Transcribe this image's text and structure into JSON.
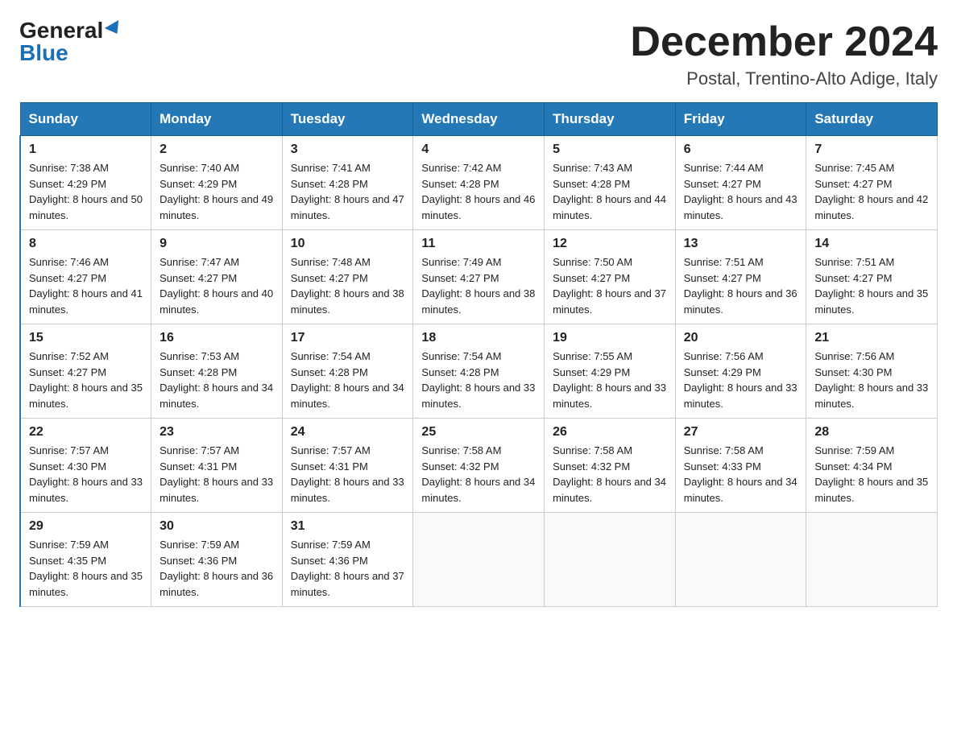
{
  "header": {
    "logo_general": "General",
    "logo_blue": "Blue",
    "month_title": "December 2024",
    "location": "Postal, Trentino-Alto Adige, Italy"
  },
  "weekdays": [
    "Sunday",
    "Monday",
    "Tuesday",
    "Wednesday",
    "Thursday",
    "Friday",
    "Saturday"
  ],
  "weeks": [
    [
      {
        "day": 1,
        "sunrise": "7:38 AM",
        "sunset": "4:29 PM",
        "daylight": "8 hours and 50 minutes."
      },
      {
        "day": 2,
        "sunrise": "7:40 AM",
        "sunset": "4:29 PM",
        "daylight": "8 hours and 49 minutes."
      },
      {
        "day": 3,
        "sunrise": "7:41 AM",
        "sunset": "4:28 PM",
        "daylight": "8 hours and 47 minutes."
      },
      {
        "day": 4,
        "sunrise": "7:42 AM",
        "sunset": "4:28 PM",
        "daylight": "8 hours and 46 minutes."
      },
      {
        "day": 5,
        "sunrise": "7:43 AM",
        "sunset": "4:28 PM",
        "daylight": "8 hours and 44 minutes."
      },
      {
        "day": 6,
        "sunrise": "7:44 AM",
        "sunset": "4:27 PM",
        "daylight": "8 hours and 43 minutes."
      },
      {
        "day": 7,
        "sunrise": "7:45 AM",
        "sunset": "4:27 PM",
        "daylight": "8 hours and 42 minutes."
      }
    ],
    [
      {
        "day": 8,
        "sunrise": "7:46 AM",
        "sunset": "4:27 PM",
        "daylight": "8 hours and 41 minutes."
      },
      {
        "day": 9,
        "sunrise": "7:47 AM",
        "sunset": "4:27 PM",
        "daylight": "8 hours and 40 minutes."
      },
      {
        "day": 10,
        "sunrise": "7:48 AM",
        "sunset": "4:27 PM",
        "daylight": "8 hours and 38 minutes."
      },
      {
        "day": 11,
        "sunrise": "7:49 AM",
        "sunset": "4:27 PM",
        "daylight": "8 hours and 38 minutes."
      },
      {
        "day": 12,
        "sunrise": "7:50 AM",
        "sunset": "4:27 PM",
        "daylight": "8 hours and 37 minutes."
      },
      {
        "day": 13,
        "sunrise": "7:51 AM",
        "sunset": "4:27 PM",
        "daylight": "8 hours and 36 minutes."
      },
      {
        "day": 14,
        "sunrise": "7:51 AM",
        "sunset": "4:27 PM",
        "daylight": "8 hours and 35 minutes."
      }
    ],
    [
      {
        "day": 15,
        "sunrise": "7:52 AM",
        "sunset": "4:27 PM",
        "daylight": "8 hours and 35 minutes."
      },
      {
        "day": 16,
        "sunrise": "7:53 AM",
        "sunset": "4:28 PM",
        "daylight": "8 hours and 34 minutes."
      },
      {
        "day": 17,
        "sunrise": "7:54 AM",
        "sunset": "4:28 PM",
        "daylight": "8 hours and 34 minutes."
      },
      {
        "day": 18,
        "sunrise": "7:54 AM",
        "sunset": "4:28 PM",
        "daylight": "8 hours and 33 minutes."
      },
      {
        "day": 19,
        "sunrise": "7:55 AM",
        "sunset": "4:29 PM",
        "daylight": "8 hours and 33 minutes."
      },
      {
        "day": 20,
        "sunrise": "7:56 AM",
        "sunset": "4:29 PM",
        "daylight": "8 hours and 33 minutes."
      },
      {
        "day": 21,
        "sunrise": "7:56 AM",
        "sunset": "4:30 PM",
        "daylight": "8 hours and 33 minutes."
      }
    ],
    [
      {
        "day": 22,
        "sunrise": "7:57 AM",
        "sunset": "4:30 PM",
        "daylight": "8 hours and 33 minutes."
      },
      {
        "day": 23,
        "sunrise": "7:57 AM",
        "sunset": "4:31 PM",
        "daylight": "8 hours and 33 minutes."
      },
      {
        "day": 24,
        "sunrise": "7:57 AM",
        "sunset": "4:31 PM",
        "daylight": "8 hours and 33 minutes."
      },
      {
        "day": 25,
        "sunrise": "7:58 AM",
        "sunset": "4:32 PM",
        "daylight": "8 hours and 34 minutes."
      },
      {
        "day": 26,
        "sunrise": "7:58 AM",
        "sunset": "4:32 PM",
        "daylight": "8 hours and 34 minutes."
      },
      {
        "day": 27,
        "sunrise": "7:58 AM",
        "sunset": "4:33 PM",
        "daylight": "8 hours and 34 minutes."
      },
      {
        "day": 28,
        "sunrise": "7:59 AM",
        "sunset": "4:34 PM",
        "daylight": "8 hours and 35 minutes."
      }
    ],
    [
      {
        "day": 29,
        "sunrise": "7:59 AM",
        "sunset": "4:35 PM",
        "daylight": "8 hours and 35 minutes."
      },
      {
        "day": 30,
        "sunrise": "7:59 AM",
        "sunset": "4:36 PM",
        "daylight": "8 hours and 36 minutes."
      },
      {
        "day": 31,
        "sunrise": "7:59 AM",
        "sunset": "4:36 PM",
        "daylight": "8 hours and 37 minutes."
      },
      null,
      null,
      null,
      null
    ]
  ]
}
